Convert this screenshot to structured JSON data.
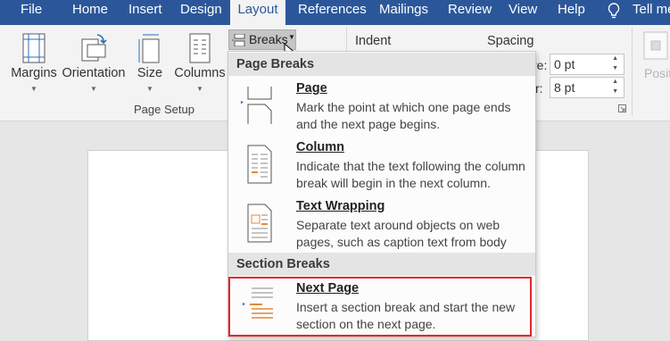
{
  "tabs": [
    "File",
    "Home",
    "Insert",
    "Design",
    "Layout",
    "References",
    "Mailings",
    "Review",
    "View",
    "Help"
  ],
  "tell_me": "Tell me",
  "page_setup": {
    "margins": "Margins",
    "orientation": "Orientation",
    "size": "Size",
    "columns": "Columns",
    "breaks": "Breaks",
    "group_label": "Page Setup"
  },
  "paragraph": {
    "indent_label": "Indent",
    "spacing_label": "Spacing",
    "before_prefix": "re:",
    "before_value": "0 pt",
    "after_prefix": "r:",
    "after_value": "8 pt"
  },
  "arrange": {
    "position": "Positi"
  },
  "breaks_menu": {
    "page_breaks_header": "Page Breaks",
    "section_breaks_header": "Section Breaks",
    "items": [
      {
        "title": "Page",
        "desc": "Mark the point at which one page ends and the next page begins."
      },
      {
        "title": "Column",
        "desc": "Indicate that the text following the column break will begin in the next column."
      },
      {
        "title": "Text Wrapping",
        "desc": "Separate text around objects on web pages, such as caption text from body text."
      },
      {
        "title": "Next Page",
        "desc": "Insert a section break and start the new section on the next page."
      }
    ]
  },
  "colors": {
    "ribbon_blue": "#2b579a",
    "highlight_red": "#e3262b"
  }
}
